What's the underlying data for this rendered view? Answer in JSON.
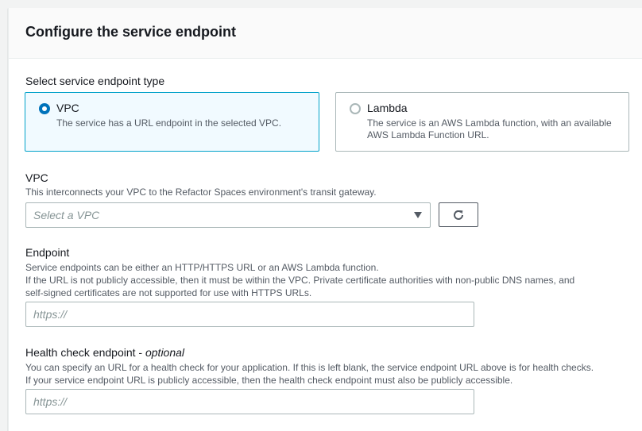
{
  "panel": {
    "title": "Configure the service endpoint"
  },
  "endpoint_type": {
    "label": "Select service endpoint type",
    "options": [
      {
        "title": "VPC",
        "description": "The service has a URL endpoint in the selected VPC.",
        "selected": true
      },
      {
        "title": "Lambda",
        "description_line1": "The service is an AWS Lambda function, with an available",
        "description_line2": "AWS Lambda Function URL.",
        "selected": false
      }
    ]
  },
  "vpc": {
    "label": "VPC",
    "description": "This interconnects your VPC to the Refactor Spaces environment's transit gateway.",
    "placeholder": "Select a VPC",
    "refresh_icon": "refresh-icon"
  },
  "endpoint": {
    "label": "Endpoint",
    "description_line1": "Service endpoints can be either an HTTP/HTTPS URL or an AWS Lambda function.",
    "description_line2": "If the URL is not publicly accessible, then it must be within the VPC. Private certificate authorities with non-public DNS names, and",
    "description_line3": "self-signed certificates are not supported for use with HTTPS URLs.",
    "placeholder": "https://"
  },
  "health_check": {
    "label": "Health check endpoint - ",
    "label_optional": "optional",
    "description_line1": "You can specify an URL for a health check for your application. If this is left blank, the service endpoint URL above is for health checks.",
    "description_line2": "If your service endpoint URL is publicly accessible, then the health check endpoint must also be publicly accessible.",
    "placeholder": "https://"
  },
  "colors": {
    "selected_border": "#00a1c9",
    "selected_bg": "#f1faff",
    "radio_on": "#0073bb",
    "placeholder": "#879596"
  }
}
